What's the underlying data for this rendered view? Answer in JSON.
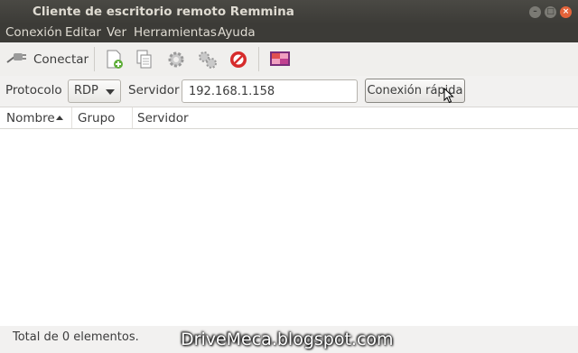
{
  "window": {
    "title": "Cliente de escritorio remoto Remmina",
    "controls": [
      "minimize",
      "maximize",
      "close"
    ]
  },
  "menubar": {
    "items": [
      "Conexión",
      "Editar",
      "Ver",
      "Herramientas",
      "Ayuda"
    ]
  },
  "toolbar": {
    "connect_label": "Conectar",
    "icons": [
      "new-connection-icon",
      "copy-icon",
      "preferences-icon",
      "plugins-icon",
      "delete-icon",
      "remote-desktop-icon"
    ]
  },
  "connection": {
    "protocol_label": "Protocolo",
    "protocol_value": "RDP",
    "server_label": "Servidor",
    "server_value": "192.168.1.158",
    "quick_connect_label": "Conexión rápida"
  },
  "list": {
    "columns": [
      "Nombre",
      "Grupo",
      "Servidor"
    ],
    "sort_column": "Nombre",
    "rows": []
  },
  "status": {
    "text": "Total de 0 elementos."
  },
  "watermark": "DriveMeca.blogspot.com",
  "colors": {
    "titlebar": "#3c3b37",
    "close_button": "#e4633a",
    "toolbar_bg": "#f0efed"
  }
}
